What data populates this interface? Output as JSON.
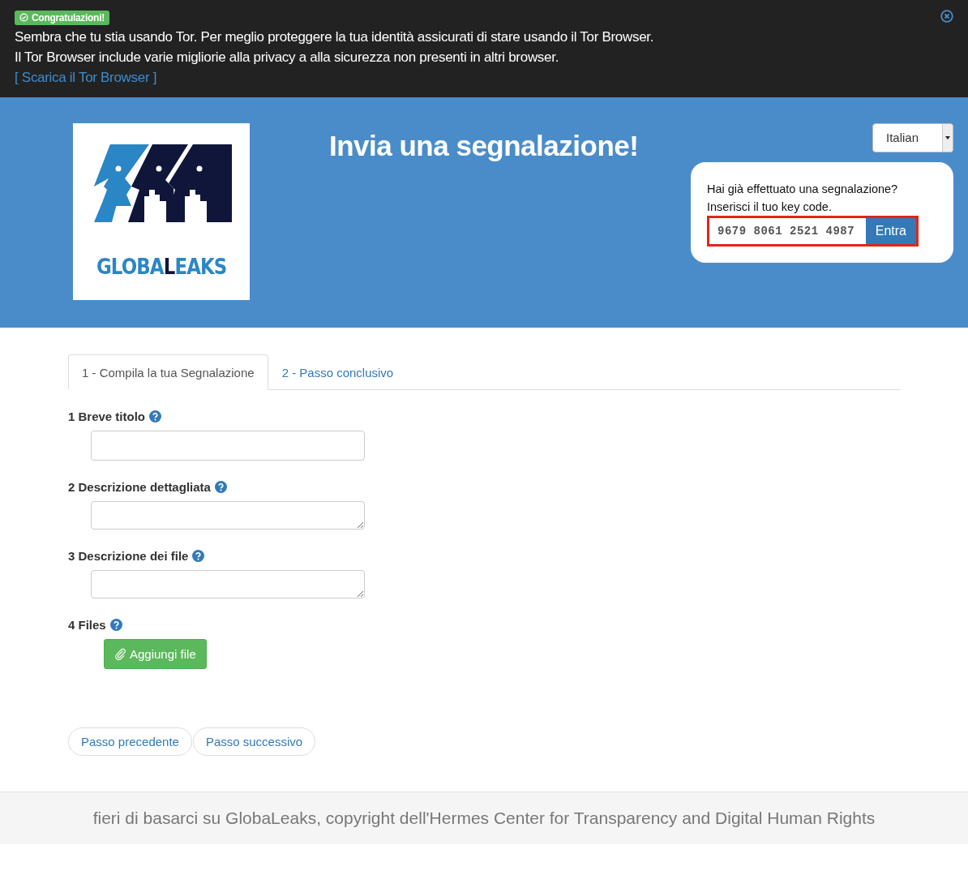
{
  "notice": {
    "badge": "Congratulazioni!",
    "lines": [
      "Sembra che tu stia usando Tor. Per meglio proteggere la tua identità assicurati di stare usando il Tor Browser.",
      "Il Tor Browser include varie migliorie alla privacy a alla sicurezza non presenti in altri browser."
    ],
    "link": "[ Scarica il Tor Browser ]"
  },
  "header": {
    "logo_parts": [
      {
        "text": "GLOBA",
        "color": "#2b86c5"
      },
      {
        "text": "L",
        "color": "#10163a"
      },
      {
        "text": "EAKS",
        "color": "#2b86c5"
      }
    ],
    "title": "Invia una segnalazione!",
    "language": "Italian",
    "login": {
      "prompt": "Hai già effettuato una segnalazione?",
      "hint": "Inserisci il tuo key code.",
      "value": "9679 8061 2521 4987",
      "button": "Entra"
    }
  },
  "tabs": [
    {
      "label": "1 - Compila la tua Segnalazione",
      "selected": true
    },
    {
      "label": "2 - Passo conclusivo",
      "selected": false
    }
  ],
  "fields": [
    {
      "label": "1 Breve titolo",
      "kind": "input"
    },
    {
      "label": "2 Descrizione dettagliata",
      "kind": "textarea"
    },
    {
      "label": "3 Descrizione dei file",
      "kind": "textarea"
    },
    {
      "label": "4 Files",
      "kind": "upload",
      "button": "Aggiungi file"
    }
  ],
  "nav_buttons": [
    "Passo precedente",
    "Passo successivo"
  ],
  "footer": "fieri di basarci su GlobaLeaks, copyright dell'Hermes Center for Transparency and Digital Human Rights"
}
